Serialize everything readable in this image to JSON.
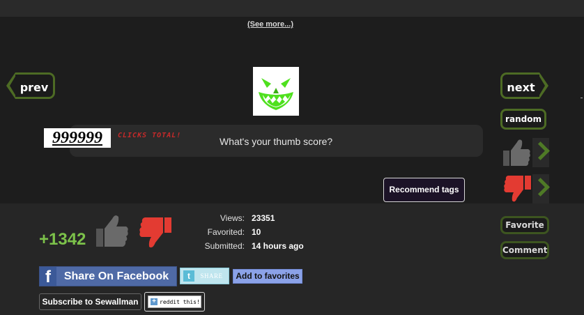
{
  "header": {
    "see_more": "(See more...)"
  },
  "nav": {
    "prev": "prev",
    "next": "next",
    "random": "random"
  },
  "counter": {
    "value": "999999",
    "label": "CLICKS TOTAL!"
  },
  "thumb_prompt": "What's your thumb score?",
  "recommend_tags": "Recommend tags",
  "side_actions": {
    "favorite": "Favorite",
    "comment": "Comment"
  },
  "score": "+1342",
  "stats": [
    {
      "key": "Views:",
      "value": "23351"
    },
    {
      "key": "Favorited:",
      "value": "10"
    },
    {
      "key": "Submitted:",
      "value": "14 hours ago"
    }
  ],
  "share": {
    "facebook_icon": "f",
    "facebook": "Share On Facebook",
    "twitter_icon": "t",
    "twitter": "SHARE",
    "add_favorites": "Add to favorites",
    "subscribe": "Subscribe to Sewallman",
    "reddit_icon": "+",
    "reddit": "reddit this!"
  },
  "colors": {
    "accent_green": "#4d6b24",
    "score_green": "#7cc24a",
    "thumb_down_red": "#e33b32",
    "pumpkin_glow": "#4fe01e"
  },
  "icons": [
    "prev-arrow-icon",
    "next-arrow-icon",
    "pumpkin-face-icon",
    "thumb-up-icon",
    "thumb-down-icon",
    "facebook-icon",
    "twitter-icon",
    "reddit-icon"
  ]
}
